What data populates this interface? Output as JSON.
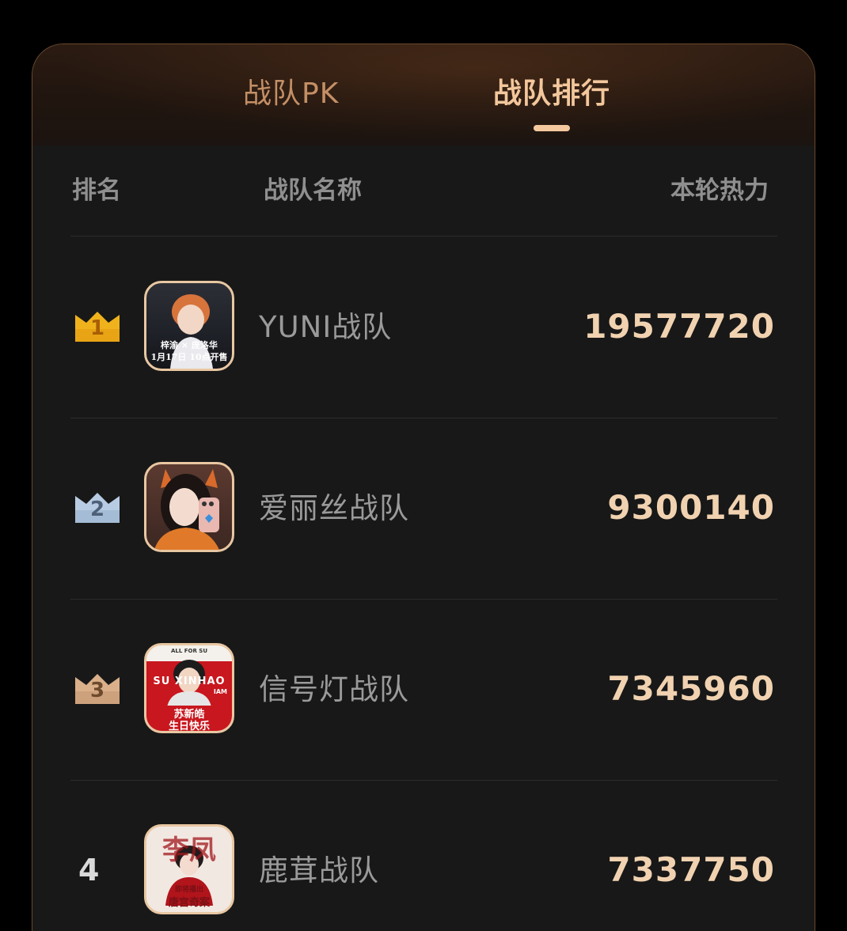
{
  "tabs": [
    {
      "label": "战队PK",
      "active": false
    },
    {
      "label": "战队排行",
      "active": true
    }
  ],
  "table": {
    "headers": {
      "rank": "排名",
      "name": "战队名称",
      "heat": "本轮热力"
    },
    "rows": [
      {
        "rank": "1",
        "name": "YUNI战队",
        "heat": "19577720",
        "avatar": {
          "line1": "梓渝 × 庞洛华",
          "line2": "1月17日 10点开售"
        }
      },
      {
        "rank": "2",
        "name": "爱丽丝战队",
        "heat": "9300140"
      },
      {
        "rank": "3",
        "name": "信号灯战队",
        "heat": "7345960",
        "avatar": {
          "top": "ALL FOR SU",
          "big": "SU XINHAO",
          "tag": "IAM",
          "line1": "苏新皓",
          "line2": "生日快乐"
        }
      },
      {
        "rank": "4",
        "name": "鹿茸战队",
        "heat": "7337750",
        "avatar": {
          "big": "李凤",
          "line1": "即将播出",
          "line2": "唐宫奇案"
        }
      }
    ]
  },
  "colors": {
    "gold": "#f0b21c",
    "silver": "#b7cce3",
    "bronze": "#d9b08a",
    "active_tab": "#f3c79c",
    "heat_value": "#f1d2b0"
  }
}
